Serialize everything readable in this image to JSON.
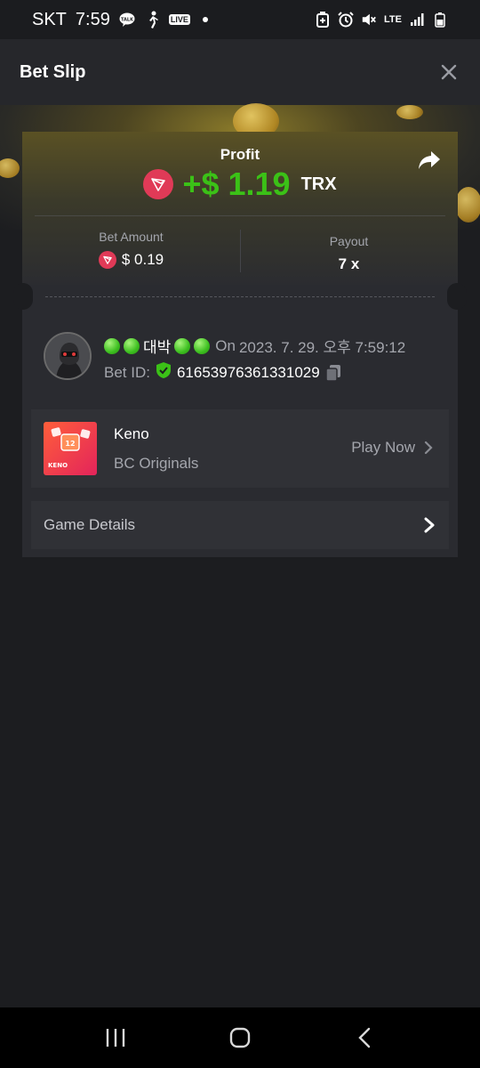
{
  "status_bar": {
    "carrier": "SKT",
    "time": "7:59",
    "live_badge": "LIVE",
    "network": "LTE",
    "icons": [
      "talk-icon",
      "walk-icon",
      "live-icon",
      "dot-icon",
      "battery-saver-icon",
      "alarm-icon",
      "mute-icon",
      "lte-icon",
      "signal-icon",
      "battery-icon"
    ]
  },
  "header": {
    "title": "Bet Slip",
    "close_icon": "close-icon"
  },
  "bet": {
    "profit_label": "Profit",
    "profit_value": "+$ 1.19",
    "profit_currency": "TRX",
    "bet_amount_label": "Bet Amount",
    "bet_amount_value": "$ 0.19",
    "payout_label": "Payout",
    "payout_value": "7 x"
  },
  "user": {
    "name": "대박",
    "date_prefix": "On",
    "date": "2023. 7. 29. 오후 7:59:12",
    "bet_id_label": "Bet ID:",
    "bet_id": "61653976361331029"
  },
  "game": {
    "name": "Keno",
    "provider": "BC Originals",
    "thumb_label": "KENO",
    "thumb_number": "12",
    "play_label": "Play Now"
  },
  "details": {
    "label": "Game Details"
  },
  "colors": {
    "profit_green": "#3bc117",
    "tron_red": "#e03a57",
    "background": "#1c1d20",
    "card": "#2a2b30"
  }
}
